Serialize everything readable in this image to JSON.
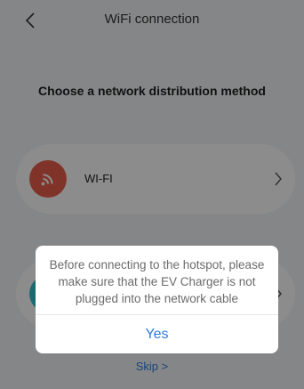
{
  "header": {
    "title": "WiFi connection"
  },
  "main": {
    "heading": "Choose a network distribution method",
    "options": [
      {
        "label": "WI-FI",
        "icon": "wifi-signal-icon",
        "color": "#e9604c"
      },
      {
        "label": "",
        "icon": "option-icon",
        "color": "#2ec3cf"
      }
    ],
    "skip_label": "Skip >"
  },
  "dialog": {
    "message": "Before connecting to the hotspot, please make sure that the EV Charger is not plugged into the network cable",
    "confirm_label": "Yes"
  },
  "colors": {
    "accent": "#2d7be0",
    "overlay": "rgba(0,0,0,0.45)"
  }
}
